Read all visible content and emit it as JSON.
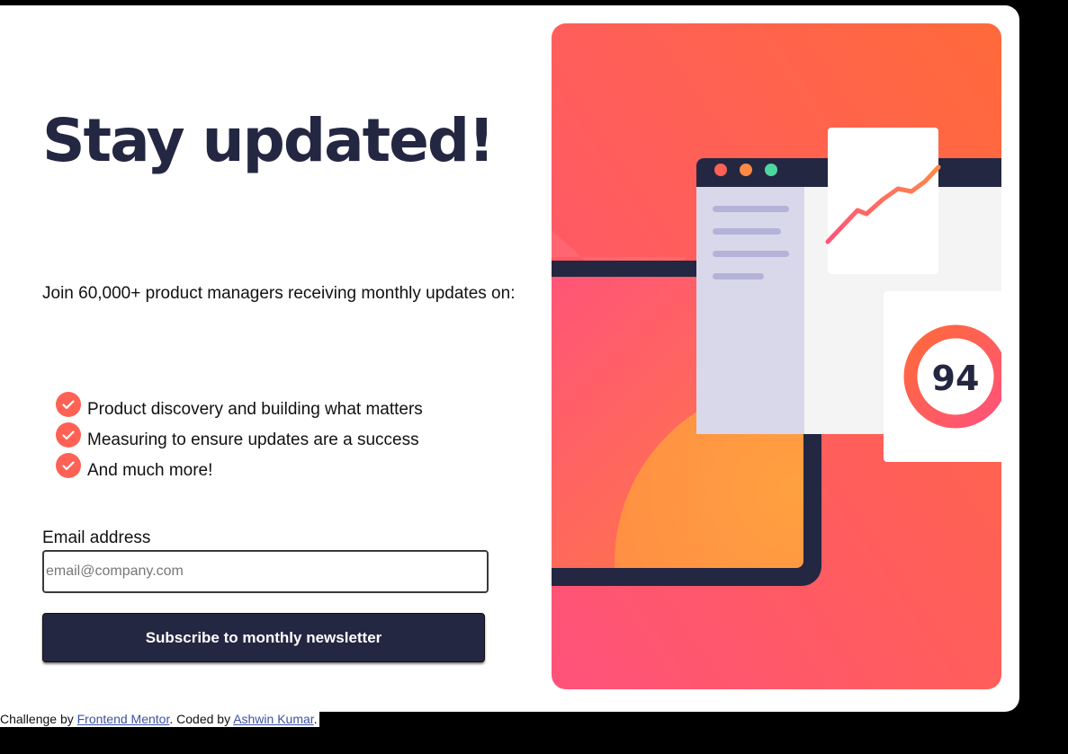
{
  "headline": "Stay updated!",
  "intro": "Join 60,000+ product managers receiving monthly updates on:",
  "features": [
    "Product discovery and building what matters",
    "Measuring to ensure updates are a success",
    "And much more!"
  ],
  "form": {
    "email_label": "Email address",
    "email_placeholder": "email@company.com",
    "email_value": "",
    "submit_label": "Subscribe to monthly newsletter"
  },
  "illustration": {
    "score": "94"
  },
  "footer": {
    "prefix": "Challenge by ",
    "challenge_link": "Frontend Mentor",
    "middle": ". Coded by ",
    "author_link": "Ashwin Kumar",
    "suffix": "."
  },
  "colors": {
    "dark_navy": "#242742",
    "tomato": "#ff6155",
    "background": "#000000",
    "card": "#ffffff",
    "link": "#3e52a3"
  },
  "icons": {
    "feature_bullet": "check-circle-icon"
  }
}
